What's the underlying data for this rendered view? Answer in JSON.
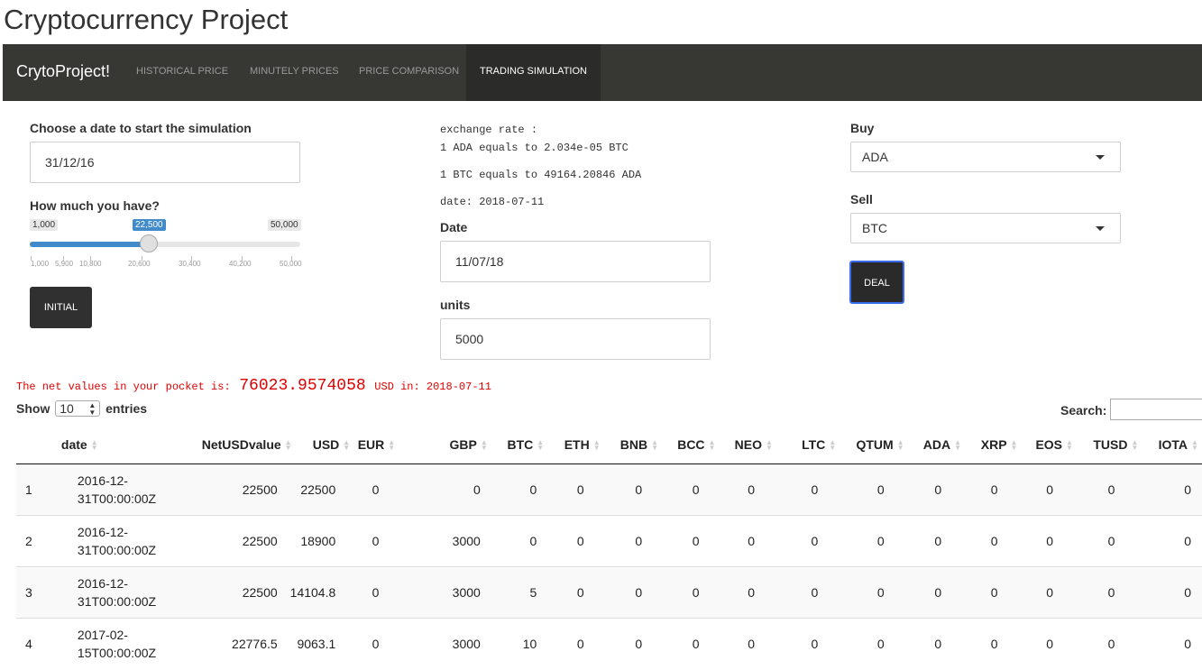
{
  "app_title": "Cryptocurrency Project",
  "navbar": {
    "brand": "CrytoProject!",
    "tabs": [
      "HISTORICAL PRICE",
      "MINUTELY PRICES",
      "PRICE COMPARISON",
      "TRADING SIMULATION"
    ],
    "active_tab": "TRADING SIMULATION"
  },
  "left_panel": {
    "date_label": "Choose a date to start the simulation",
    "date_value": "31/12/16",
    "amount_label": "How much you have?",
    "slider": {
      "min_label": "1,000",
      "max_label": "50,000",
      "value_label": "22,500",
      "value": 22500,
      "min": 1000,
      "max": 50000,
      "ticks": [
        "1,000",
        "5,900",
        "10,800",
        "20,600",
        "30,400",
        "40,200",
        "50,000"
      ],
      "accent": "#428bca"
    },
    "initial_button": "INITIAL"
  },
  "middle_panel": {
    "exchange_header": "exchange rate :",
    "rate_line1": "1 ADA equals to 2.034e-05 BTC",
    "rate_line2": "1 BTC equals to 49164.20846 ADA",
    "rate_date": "date: 2018-07-11",
    "date_label": "Date",
    "date_value": "11/07/18",
    "units_label": "units",
    "units_value": "5000"
  },
  "right_panel": {
    "buy_label": "Buy",
    "buy_value": "ADA",
    "sell_label": "Sell",
    "sell_value": "BTC",
    "deal_button": "DEAL"
  },
  "net_value": {
    "prefix": "The net values in your pocket is:",
    "amount": "76023.9574058",
    "suffix": "USD in: 2018-07-11",
    "color": "#e00000"
  },
  "table_controls": {
    "show_label": "Show",
    "page_size": "10",
    "entries_label": "entries",
    "search_label": "Search:"
  },
  "table": {
    "columns": [
      "",
      "date",
      "NetUSDvalue",
      "USD",
      "EUR",
      "GBP",
      "BTC",
      "ETH",
      "BNB",
      "BCC",
      "NEO",
      "LTC",
      "QTUM",
      "ADA",
      "XRP",
      "EOS",
      "TUSD",
      "IOTA"
    ],
    "rows": [
      [
        "1",
        "2016-12-31T00:00:00Z",
        "22500",
        "22500",
        "0",
        "0",
        "0",
        "0",
        "0",
        "0",
        "0",
        "0",
        "0",
        "0",
        "0",
        "0",
        "0",
        "0"
      ],
      [
        "2",
        "2016-12-31T00:00:00Z",
        "22500",
        "18900",
        "0",
        "3000",
        "0",
        "0",
        "0",
        "0",
        "0",
        "0",
        "0",
        "0",
        "0",
        "0",
        "0",
        "0"
      ],
      [
        "3",
        "2016-12-31T00:00:00Z",
        "22500",
        "14104.8",
        "0",
        "3000",
        "5",
        "0",
        "0",
        "0",
        "0",
        "0",
        "0",
        "0",
        "0",
        "0",
        "0",
        "0"
      ],
      [
        "4",
        "2017-02-15T00:00:00Z",
        "22776.5",
        "9063.1",
        "0",
        "3000",
        "10",
        "0",
        "0",
        "0",
        "0",
        "0",
        "0",
        "0",
        "0",
        "0",
        "0",
        "0"
      ]
    ]
  }
}
